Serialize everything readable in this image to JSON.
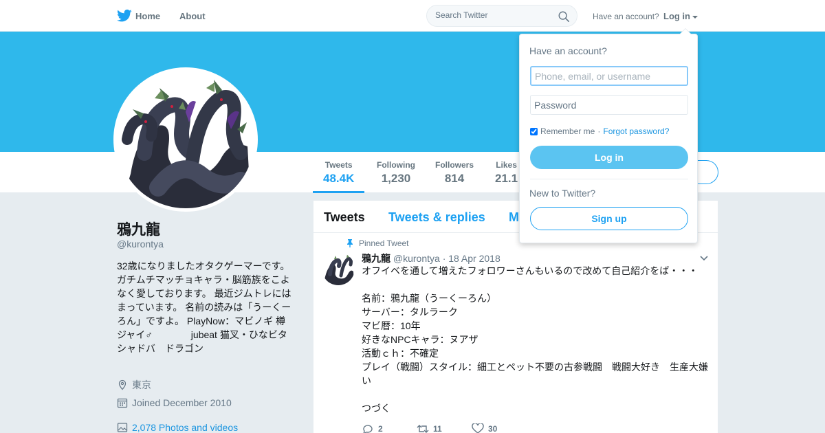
{
  "nav": {
    "home_label": "Home",
    "about_label": "About",
    "search_placeholder": "Search Twitter",
    "have_account_text": "Have an account?",
    "login_label": "Log in"
  },
  "colors": {
    "brand": "#1da1f2",
    "banner": "#2fb8eb",
    "login_button": "#5bc4f1"
  },
  "profile": {
    "name": "鴉九龍",
    "handle": "@kurontya",
    "bio": "32歳になりましたオタクゲーマーです。ガチムチマッチョキャラ・脳筋族をこよなく愛しております。 最近ジムトレにはまっています。 名前の読みは「うーくーろん」ですよ。 PlayNow：マビノギ 樽　ジャイ♂　　　　jubeat 猫叉・ひなビタ　　　　シャドバ　ドラゴン",
    "location": "東京",
    "joined": "Joined December 2010",
    "photos": "2,078 Photos and videos"
  },
  "stats": [
    {
      "label": "Tweets",
      "value": "48.4K"
    },
    {
      "label": "Following",
      "value": "1,230"
    },
    {
      "label": "Followers",
      "value": "814"
    },
    {
      "label": "Likes",
      "value": "21.1"
    }
  ],
  "timeline": {
    "tabs": [
      "Tweets",
      "Tweets & replies",
      "M"
    ],
    "pinned_label": "Pinned Tweet",
    "tweet": {
      "name": "鴉九龍",
      "meta": "@kurontya · 18 Apr 2018",
      "text": "オフイベを通して増えたフォロワーさんもいるので改めて自己紹介をば・・・\n\n名前：鴉九龍（うーくーろん）\nサーバー：タルラーク\nマビ暦：10年\n好きなNPCキャラ：ヌアザ\n活動ｃｈ：不確定\nプレイ（戦闘）スタイル：細工とペット不要の古参戦闘　戦闘大好き　生産大嫌い\n\nつづく",
      "replies": "2",
      "retweets": "11",
      "likes": "30"
    }
  },
  "login_dropdown": {
    "title": "Have an account?",
    "username_placeholder": "Phone, email, or username",
    "password_placeholder": "Password",
    "remember_label": "Remember me",
    "separator": "·",
    "forgot_label": "Forgot password?",
    "login_button": "Log in",
    "new_label": "New to Twitter?",
    "signup_button": "Sign up"
  }
}
